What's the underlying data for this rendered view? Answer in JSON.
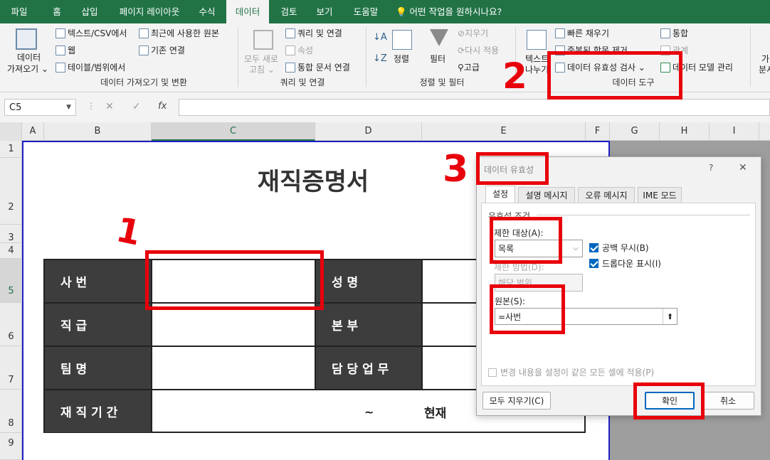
{
  "tabs": {
    "file": "파일",
    "home": "홈",
    "insert": "삽입",
    "page_layout": "페이지 레이아웃",
    "formulas": "수식",
    "data": "데이터",
    "review": "검토",
    "view": "보기",
    "help": "도움말",
    "tell_me": "어떤 작업을 원하시나요?"
  },
  "ribbon": {
    "get_data_l1": "데이터",
    "get_data_l2": "가져오기 ⌄",
    "text_csv": "텍스트/CSV에서",
    "web": "웹",
    "table_range": "테이블/범위에서",
    "recent_sources": "최근에 사용한 원본",
    "existing_conn": "기존 연결",
    "group_get": "데이터 가져오기 및 변환",
    "refresh_l1": "모두 새로",
    "refresh_l2": "고침 ⌄",
    "queries_conn": "쿼리 및 연결",
    "properties": "속성",
    "edit_links": "통합 문서 연결",
    "group_queries": "쿼리 및 연결",
    "sort": "정렬",
    "filter": "필터",
    "clear": "지우기",
    "reapply": "다시 적용",
    "advanced": "고급",
    "group_sort": "정렬 및 필터",
    "text_to_cols_l1": "텍스트",
    "text_to_cols_l2": "나누기",
    "flash_fill": "빠른 채우기",
    "remove_dup": "중복된 항목 제거",
    "data_validation": "데이터 유효성 검사  ⌄",
    "consolidate": "통합",
    "relationships": "관계",
    "data_model": "데이터 모델 관리",
    "group_tools": "데이터 도구",
    "cut_l1": "가",
    "cut_l2": "분시"
  },
  "formula_bar": {
    "name_box": "C5",
    "cancel": "✕",
    "enter": "✓",
    "fx": "fx",
    "value": ""
  },
  "columns": [
    "A",
    "B",
    "C",
    "D",
    "E",
    "F",
    "G",
    "H",
    "I"
  ],
  "rows": [
    "1",
    "2",
    "3",
    "4",
    "5",
    "6",
    "7",
    "8",
    "9"
  ],
  "sheet": {
    "title": "재직증명서",
    "emp_no": "사      번",
    "name": "성      명",
    "rank": "직      급",
    "reg": "본      부",
    "team": "팀      명",
    "duty": "담 당 업 무",
    "period": "재 직 기 간",
    "tilde": "~",
    "current": "현재"
  },
  "dialog": {
    "title": "데이터 유효성",
    "help": "?",
    "close": "✕",
    "tab_settings": "설정",
    "tab_input": "설명 메시지",
    "tab_error": "오류 메시지",
    "tab_ime": "IME 모드",
    "criteria": "유효성 조건",
    "allow_label": "제한 대상(A):",
    "allow_value": "목록",
    "ignore_blank": "공백 무시(B)",
    "dropdown": "드롭다운 표시(I)",
    "data_label": "제한 방법(D):",
    "data_value": "해당 범위",
    "source_label": "원본(S):",
    "source_value": "=사번",
    "apply_all": "변경 내용을 설정이 같은 모든 셀에 적용(P)",
    "clear_all": "모두 지우기(C)",
    "ok": "확인",
    "cancel": "취소"
  },
  "annotations": {
    "one": "1",
    "two": "2",
    "three": "3"
  },
  "accent": "#217346",
  "annotation_color": "#e8000b"
}
